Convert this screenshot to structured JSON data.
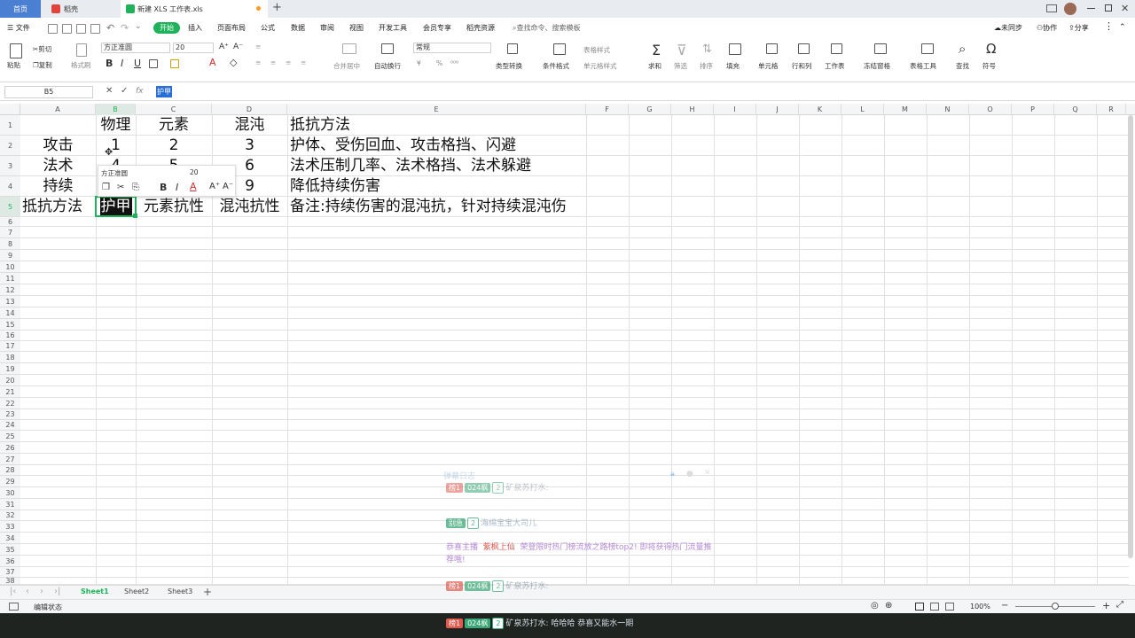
{
  "tabs": {
    "home": "首页",
    "wps": "稻壳",
    "doc": "新建 XLS 工作表.xls",
    "plus": "+"
  },
  "menu": {
    "file": "文件",
    "items": [
      "开始",
      "插入",
      "页面布局",
      "公式",
      "数据",
      "审阅",
      "视图",
      "开发工具",
      "会员专享",
      "稻壳资源"
    ],
    "search": "查找命令、搜索模板",
    "sync": "未同步",
    "collab": "协作",
    "share": "分享"
  },
  "ribbon": {
    "paste": "粘贴",
    "cut": "剪切",
    "copy": "复制",
    "format_painter": "格式刷",
    "font": "方正准圆",
    "size": "20",
    "number_format": "常规",
    "merge": "合并居中",
    "wrap": "自动换行",
    "type_convert": "类型转换",
    "cond_format": "条件格式",
    "table_style": "表格样式",
    "cell_style": "单元格样式",
    "sum": "求和",
    "filter": "筛选",
    "sort": "排序",
    "fill": "填充",
    "cells": "单元格",
    "rowcol": "行和列",
    "sheet": "工作表",
    "freeze": "冻结窗格",
    "table_tools": "表格工具",
    "find": "查找",
    "symbol": "符号"
  },
  "formula_bar": {
    "name_box": "B5",
    "fx": "fx",
    "value": "护甲"
  },
  "columns": [
    "A",
    "B",
    "C",
    "D",
    "E",
    "F",
    "G",
    "H",
    "I",
    "J",
    "K",
    "L",
    "M",
    "N",
    "O",
    "P",
    "Q",
    "R"
  ],
  "rows": [
    "1",
    "2",
    "3",
    "4",
    "5",
    "6",
    "7",
    "8",
    "9",
    "10",
    "11",
    "12",
    "13",
    "14",
    "15",
    "16",
    "17",
    "18",
    "19",
    "20",
    "21",
    "22",
    "23",
    "24",
    "25",
    "26",
    "27",
    "28",
    "29",
    "30",
    "31",
    "32",
    "33",
    "34",
    "35",
    "36",
    "37",
    "38"
  ],
  "cells": {
    "B1": "物理",
    "C1": "元素",
    "D1": "混沌",
    "E1": "抵抗方法",
    "A2": "攻击",
    "B2": "1",
    "C2": "2",
    "D2": "3",
    "E2": "护体、受伤回血、攻击格挡、闪避",
    "A3": "法术",
    "B3": "4",
    "C3": "5",
    "D3": "6",
    "E3": "法术压制几率、法术格挡、法术躲避",
    "A4": "持续",
    "D4": "9",
    "E4": "降低持续伤害",
    "A5": "抵抗方法",
    "B5": "护甲",
    "C5": "元素抗性",
    "D5": "混沌抗性",
    "E5": "备注:持续伤害的混沌抗，针对持续混沌伤"
  },
  "mini_toolbar": {
    "font": "方正准圆",
    "size": "20"
  },
  "sheets": [
    "Sheet1",
    "Sheet2",
    "Sheet3"
  ],
  "status": {
    "mode": "编辑状态",
    "zoom": "100%"
  },
  "overlay": {
    "header": "弹幕日志",
    "msg1": {
      "badge1": "榜1",
      "badge2": "024枫",
      "level": "2",
      "text": "矿泉苏打水:"
    },
    "msg2": {
      "badge1": "别急",
      "level": "2",
      "text": "海绵宝宝大司儿"
    },
    "msg3": {
      "prefix": "恭喜主播",
      "name": "紫枫上仙",
      "text": "荣登限时热门榜流放之路榜top2! 即将获得热门流量推荐哦!"
    },
    "msg4": {
      "badge1": "榜1",
      "badge2": "024枫",
      "level": "2",
      "text": "矿泉苏打水:"
    },
    "msg5": {
      "badge1": "榜1",
      "badge2": "024枫",
      "level": "2",
      "text": "矿泉苏打水: 哈哈哈  恭喜又能水一期"
    }
  },
  "colors": {
    "accent": "#1fb25a",
    "selection": "#2b6fd6",
    "badge_red": "#e05a4f",
    "badge_green": "#3aa776",
    "overlay_purple": "#b48ad6"
  }
}
